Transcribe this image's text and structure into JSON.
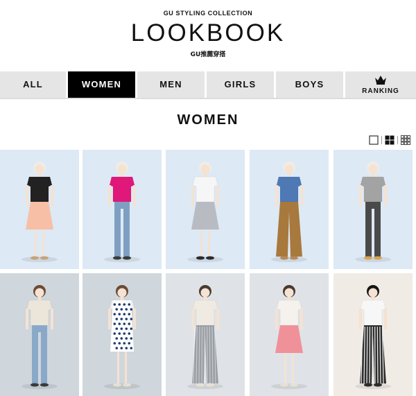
{
  "header": {
    "subtitle": "GU STYLING COLLECTION",
    "title": "LOOKBOOK",
    "caption": "GU推薦穿搭"
  },
  "tabs": [
    {
      "label": "ALL",
      "active": false
    },
    {
      "label": "WOMEN",
      "active": true
    },
    {
      "label": "MEN",
      "active": false
    },
    {
      "label": "GIRLS",
      "active": false
    },
    {
      "label": "BOYS",
      "active": false
    },
    {
      "label": "RANKING",
      "active": false,
      "icon": "crown-icon"
    }
  ],
  "section_title": "WOMEN",
  "view_toggles": [
    {
      "name": "single-view-icon",
      "selected": false
    },
    {
      "name": "grid-view-icon",
      "selected": true
    },
    {
      "name": "dense-grid-view-icon",
      "selected": false
    }
  ],
  "looks": [
    {
      "background": "#dde9f5",
      "top": "#222222",
      "bottom": "#f7c0a6",
      "bottom_type": "skirt",
      "shoes": "#c8a27a",
      "hair": "#f1ece3"
    },
    {
      "background": "#dde9f5",
      "top": "#e0187a",
      "bottom": "#7e9fc2",
      "bottom_type": "jeans",
      "shoes": "#3a3a3a",
      "hair": "#f1ece3"
    },
    {
      "background": "#dde9f5",
      "top": "#f6f6f6",
      "bottom": "#b8bcc2",
      "bottom_type": "skirt",
      "shoes": "#2b2b2b",
      "hair": "#f1ece3"
    },
    {
      "background": "#dde9f5",
      "top": "#4e79b5",
      "bottom": "#a8793d",
      "bottom_type": "wide",
      "shoes": "#b88a5a",
      "hair": "#f1ece3"
    },
    {
      "background": "#dde9f5",
      "top": "#a3a3a3",
      "bottom": "#4a4a4a",
      "bottom_type": "leggings",
      "shoes": "#d8a450",
      "hair": "#f1ece3"
    },
    {
      "background": "#cfd6dc",
      "top": "#ece6da",
      "bottom": "#8aa9c9",
      "bottom_type": "jeans",
      "shoes": "#3a3a3a",
      "hair": "#6b4a34"
    },
    {
      "background": "#cfd6dc",
      "top": "#eeeeee",
      "bottom": "#ffffff",
      "bottom_type": "dress",
      "shoes": "#e8e0d2",
      "hair": "#6b4a34"
    },
    {
      "background": "#dfe3e7",
      "top": "#efeae2",
      "bottom": "#9a9fa5",
      "bottom_type": "pleated",
      "shoes": "#e8e0d2",
      "hair": "#4a3a2e"
    },
    {
      "background": "#dfe3e7",
      "top": "#f5f1ec",
      "bottom": "#f0919a",
      "bottom_type": "skirt",
      "shoes": "#e8e0d2",
      "hair": "#4a3a2e"
    },
    {
      "background": "#f0ebe5",
      "top": "#f7f7f7",
      "bottom": "#2c2c2c",
      "bottom_type": "striped",
      "shoes": "#2b2b2b",
      "hair": "#151515"
    }
  ]
}
